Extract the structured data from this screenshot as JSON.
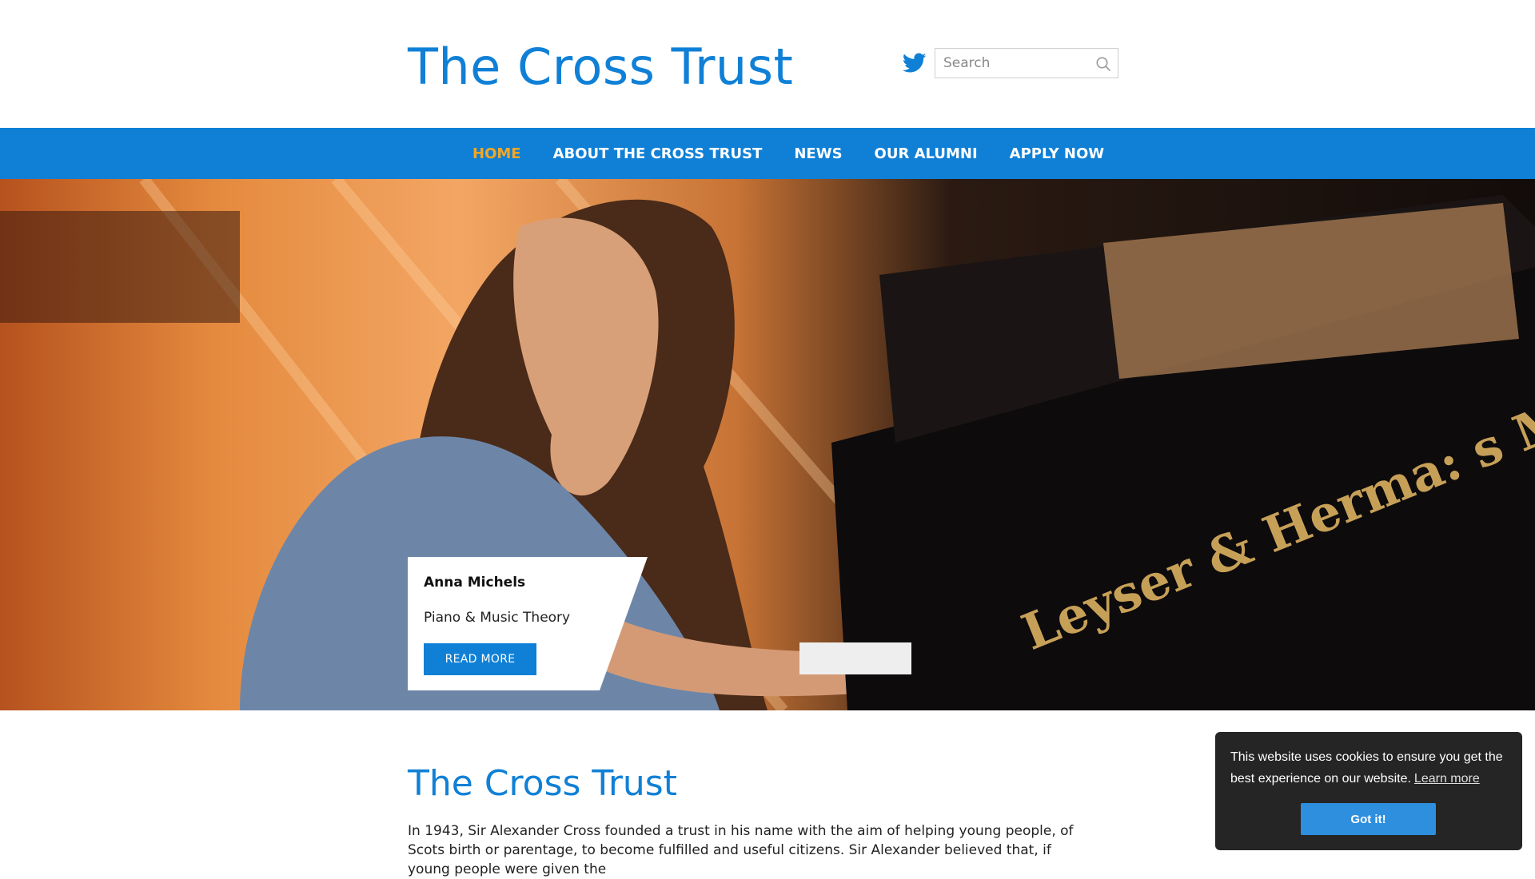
{
  "header": {
    "site_title": "The Cross Trust",
    "search_placeholder": "Search"
  },
  "nav": {
    "items": [
      {
        "label": "HOME",
        "active": true
      },
      {
        "label": "ABOUT THE CROSS TRUST",
        "active": false
      },
      {
        "label": "NEWS",
        "active": false
      },
      {
        "label": "OUR ALUMNI",
        "active": false
      },
      {
        "label": "APPLY NOW",
        "active": false
      }
    ]
  },
  "hero": {
    "name": "Anna Michels",
    "subtitle": "Piano & Music Theory",
    "button_label": "READ MORE",
    "piano_text": "Leyser & Herma: s Maastri"
  },
  "content": {
    "title": "The Cross Trust",
    "body": "In 1943, Sir Alexander Cross founded a trust in his name with the aim of helping young people, of Scots birth or parentage, to become fulfilled and useful citizens. Sir Alexander believed that, if young people were given the"
  },
  "cookie": {
    "message": "This website uses cookies to ensure you get the best experience on our website.",
    "learn_more": "Learn more",
    "accept_label": "Got it!"
  },
  "colors": {
    "brand_blue": "#1080d6",
    "active_nav": "#f5a623",
    "cookie_bg": "#252525",
    "cookie_button": "#2e8fdf"
  },
  "icons": [
    "twitter-icon",
    "search-icon"
  ]
}
